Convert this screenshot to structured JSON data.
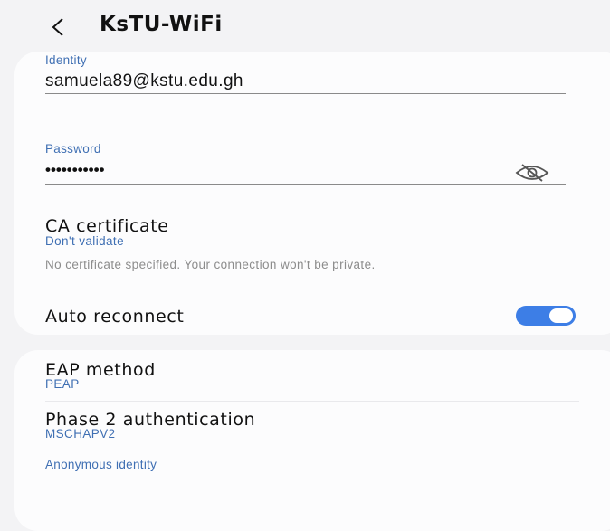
{
  "header": {
    "title": "KsTU-WiFi",
    "back_icon": "chevron-left-icon"
  },
  "identity": {
    "label": "Identity",
    "value": "samuela89@kstu.edu.gh"
  },
  "password": {
    "label": "Password",
    "value": "•••••••••••",
    "visibility_icon": "eye-off-icon"
  },
  "ca_certificate": {
    "title": "CA certificate",
    "value": "Don't validate",
    "hint": "No certificate specified. Your connection won't be private."
  },
  "auto_reconnect": {
    "title": "Auto reconnect",
    "enabled": true
  },
  "eap_method": {
    "title": "EAP method",
    "value": "PEAP"
  },
  "phase2": {
    "title": "Phase 2 authentication",
    "value": "MSCHAPV2"
  },
  "anonymous_identity": {
    "label": "Anonymous identity",
    "value": ""
  },
  "colors": {
    "accent": "#3f6fb3",
    "toggle_on": "#3d7ee6",
    "background": "#f3f3f5",
    "card": "#fcfcfd",
    "hint_text": "#8c8c8c"
  }
}
